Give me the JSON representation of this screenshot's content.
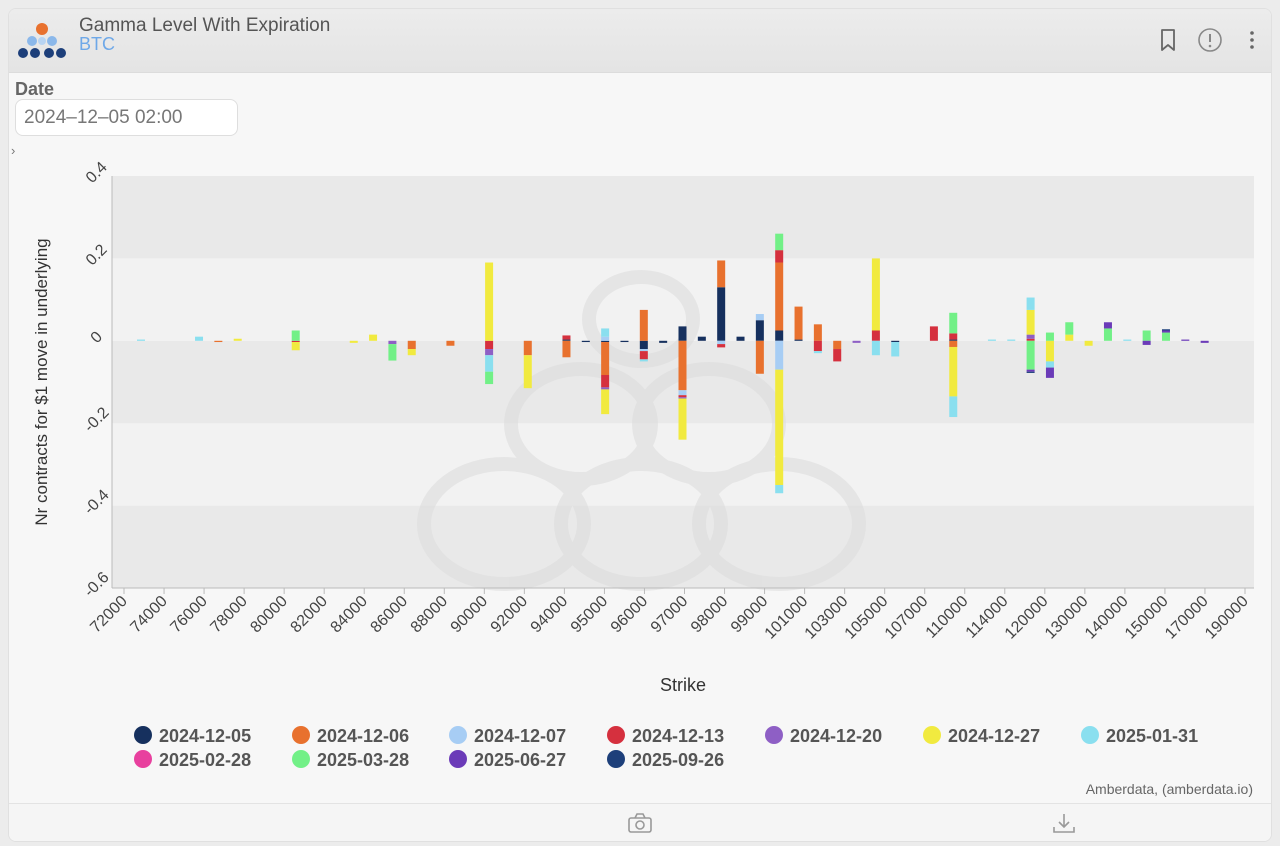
{
  "header": {
    "title": "Gamma Level With Expiration",
    "subtitle": "BTC"
  },
  "filters": {
    "date_label": "Date",
    "date_value": "2024–12–05 02:00"
  },
  "icons": {
    "bookmark": "bookmark-icon",
    "info": "info-icon",
    "menu": "more-vertical-icon",
    "camera": "camera-icon",
    "download": "download-icon",
    "expand": "chevron-right-icon"
  },
  "credit": "Amberdata, (amberdata.io)",
  "chart_data": {
    "type": "bar",
    "stacked": true,
    "xlabel": "Strike",
    "ylabel": "Nr contracts for $1 move in underlying",
    "ylim": [
      -0.6,
      0.4
    ],
    "yticks": [
      "0.4",
      "0.2",
      "0",
      "-0.2",
      "-0.4",
      "-0.6"
    ],
    "grid": "horizontal bands",
    "legend_position": "bottom",
    "categories": [
      "72000",
      "73000",
      "74000",
      "75000",
      "76000",
      "77000",
      "78000",
      "79000",
      "80000",
      "81000",
      "82000",
      "83000",
      "84000",
      "85000",
      "86000",
      "87000",
      "88000",
      "89000",
      "90000",
      "91000",
      "92000",
      "93000",
      "94000",
      "94500",
      "95000",
      "95500",
      "96000",
      "96500",
      "97000",
      "97500",
      "98000",
      "98500",
      "99000",
      "100000",
      "101000",
      "102000",
      "103000",
      "104000",
      "105000",
      "106000",
      "107000",
      "108000",
      "110000",
      "112000",
      "114000",
      "115000",
      "120000",
      "125000",
      "130000",
      "135000",
      "140000",
      "145000",
      "150000",
      "160000",
      "170000",
      "180000",
      "190000"
    ],
    "tick_labels": [
      "72000",
      "74000",
      "76000",
      "78000",
      "80000",
      "82000",
      "84000",
      "86000",
      "88000",
      "90000",
      "92000",
      "94000",
      "95000",
      "96000",
      "97000",
      "98000",
      "99000",
      "101000",
      "103000",
      "105000",
      "107000",
      "110000",
      "114000",
      "120000",
      "130000",
      "140000",
      "150000",
      "170000",
      "190000"
    ],
    "series": [
      {
        "name": "2024-12-05",
        "color": "#16305e",
        "values": [
          0,
          0,
          0,
          0,
          0,
          0,
          0,
          0,
          0,
          0,
          0,
          0,
          0,
          0,
          0,
          0,
          0,
          0,
          0,
          0,
          0,
          0,
          0.003,
          -0.003,
          -0.003,
          -0.003,
          -0.02,
          -0.005,
          0.035,
          0.01,
          0.13,
          0.01,
          0.05,
          0.025,
          0.003,
          0,
          0,
          0,
          0,
          -0.003,
          0,
          0,
          0.003,
          0,
          0,
          0,
          0,
          0,
          0,
          0,
          0,
          0,
          0,
          0,
          0,
          0,
          0
        ]
      },
      {
        "name": "2024-12-06",
        "color": "#e8712e",
        "values": [
          0,
          0,
          0,
          0,
          -0.003,
          0,
          0,
          0,
          0,
          0,
          0,
          0,
          0,
          0,
          -0.02,
          0,
          -0.012,
          0,
          0,
          0,
          -0.035,
          0,
          -0.04,
          0,
          -0.08,
          0,
          0.075,
          0,
          -0.12,
          0,
          0.065,
          0,
          -0.08,
          0.165,
          0.08,
          0.04,
          -0.02,
          0,
          0,
          0,
          0,
          0,
          -0.015,
          0,
          0,
          0,
          0,
          0,
          0,
          0,
          0,
          0,
          0,
          0,
          0,
          0,
          0
        ]
      },
      {
        "name": "2024-12-07",
        "color": "#a7cdf4",
        "values": [
          0,
          0,
          0,
          0,
          0,
          0,
          0,
          0,
          0,
          0,
          0,
          0,
          0,
          0,
          0,
          0,
          0,
          0,
          0,
          0,
          0,
          0,
          0,
          0,
          0.01,
          0,
          -0.005,
          0,
          -0.012,
          0,
          -0.008,
          0,
          0.015,
          -0.07,
          0,
          0,
          0,
          0,
          0,
          0,
          0,
          0,
          0,
          0,
          0,
          0,
          0,
          0,
          0,
          0,
          0,
          0,
          0,
          0,
          0,
          0,
          0
        ]
      },
      {
        "name": "2024-12-13",
        "color": "#d5303e",
        "values": [
          0,
          0,
          0,
          0,
          0,
          0,
          0,
          0,
          -0.003,
          0,
          0,
          0,
          0,
          0,
          0,
          0,
          0,
          0,
          -0.02,
          0,
          0,
          0,
          0.01,
          0,
          -0.03,
          0,
          -0.02,
          0,
          -0.005,
          0,
          -0.008,
          0,
          0,
          0.03,
          0,
          -0.025,
          -0.03,
          0,
          0.025,
          0,
          0,
          0.035,
          0.015,
          0,
          0,
          0,
          0.005,
          0,
          0,
          0,
          0,
          0,
          0,
          0,
          0,
          0,
          0
        ]
      },
      {
        "name": "2024-12-20",
        "color": "#8e5fc5",
        "values": [
          0,
          0,
          0,
          0,
          0,
          0,
          0,
          0,
          0,
          0,
          0,
          0,
          0,
          -0.008,
          0,
          0,
          0,
          0,
          -0.015,
          0,
          0,
          0,
          0,
          0,
          -0.005,
          0,
          0,
          0,
          -0.003,
          0,
          0,
          0,
          0,
          0,
          0,
          0,
          0,
          -0.005,
          0,
          0,
          0,
          0,
          0,
          0,
          0,
          0,
          0.01,
          0,
          0,
          0,
          0,
          0,
          0,
          0,
          0,
          0,
          0
        ]
      },
      {
        "name": "2024-12-27",
        "color": "#f1ea3f",
        "values": [
          0,
          0,
          0,
          0,
          0,
          0.005,
          0,
          0,
          -0.02,
          0,
          0,
          -0.005,
          0.015,
          0,
          -0.015,
          0,
          0,
          0,
          0.19,
          0,
          -0.08,
          0,
          0,
          0,
          -0.06,
          0,
          0,
          0,
          -0.1,
          0,
          0,
          0,
          0,
          -0.28,
          0,
          0,
          0,
          0,
          0.175,
          0,
          0,
          0,
          -0.12,
          0,
          0,
          0,
          0.06,
          -0.05,
          0.015,
          -0.012,
          0,
          0,
          0,
          0,
          0,
          0,
          0
        ]
      },
      {
        "name": "2025-01-31",
        "color": "#8adfef",
        "values": [
          0.003,
          0,
          0,
          0.01,
          0,
          0,
          0,
          0,
          0,
          0,
          0,
          0,
          0,
          0,
          0,
          0,
          0,
          0,
          -0.04,
          0,
          0,
          0,
          0,
          0,
          0.02,
          0,
          -0.005,
          0,
          0,
          0,
          0,
          0,
          0,
          -0.02,
          0,
          -0.005,
          0,
          0,
          -0.035,
          -0.035,
          0,
          0,
          -0.05,
          0,
          0.003,
          0.003,
          0.03,
          -0.015,
          0,
          0,
          0,
          0.003,
          0,
          0,
          0,
          0,
          0
        ]
      },
      {
        "name": "2025-02-28",
        "color": "#e8409e",
        "values": [
          0,
          0,
          0,
          0,
          0,
          0,
          0,
          0,
          0,
          0,
          0,
          0,
          0,
          0,
          0,
          0,
          0,
          0,
          0,
          0,
          0,
          0,
          0,
          0,
          0,
          0,
          0,
          0,
          0,
          0,
          0,
          0,
          0,
          0,
          0,
          0,
          0,
          0,
          0,
          0,
          0,
          0,
          0,
          0,
          0,
          0,
          0,
          0,
          0,
          0,
          0,
          0,
          0,
          0,
          0,
          0,
          0
        ]
      },
      {
        "name": "2025-03-28",
        "color": "#72f087",
        "values": [
          0,
          0,
          0,
          0,
          0,
          0,
          0,
          0,
          0.025,
          0,
          0,
          0,
          0,
          -0.04,
          0,
          0,
          0,
          0,
          -0.03,
          0,
          0,
          0,
          0,
          0,
          0,
          0,
          0,
          0,
          0,
          0,
          0,
          0,
          0,
          0.04,
          0,
          0,
          0,
          0,
          0,
          0,
          0,
          0,
          0.05,
          0,
          0,
          0,
          -0.07,
          0.02,
          0.03,
          0,
          0.03,
          0,
          0.025,
          0.02,
          0,
          0,
          0
        ]
      },
      {
        "name": "2025-06-27",
        "color": "#6b3bb8",
        "values": [
          0,
          0,
          0,
          0,
          0,
          0,
          0,
          0,
          0,
          0,
          0,
          0,
          0,
          0,
          0,
          0,
          0,
          0,
          0,
          0,
          0,
          0,
          0,
          0,
          0,
          0,
          0,
          0,
          0,
          0,
          0,
          0,
          0,
          0,
          0,
          0,
          0,
          0,
          0,
          0,
          0,
          0,
          0,
          0,
          0,
          0,
          -0.005,
          -0.025,
          0,
          0,
          0.015,
          0,
          -0.01,
          0.005,
          0.003,
          -0.005,
          0
        ]
      },
      {
        "name": "2025-09-26",
        "color": "#1d3f7a",
        "values": [
          0,
          0,
          0,
          0,
          0,
          0,
          0,
          0,
          0,
          0,
          0,
          0,
          0,
          0,
          0,
          0,
          0,
          0,
          0,
          0,
          0,
          0,
          0,
          0,
          0,
          0,
          0,
          0,
          0,
          0,
          0,
          0,
          0,
          0,
          0,
          0,
          0,
          0,
          0,
          0,
          0,
          0,
          0,
          0,
          0,
          0,
          -0.003,
          0,
          0,
          0,
          0,
          0,
          0,
          0.003,
          0,
          0,
          0
        ]
      }
    ]
  }
}
